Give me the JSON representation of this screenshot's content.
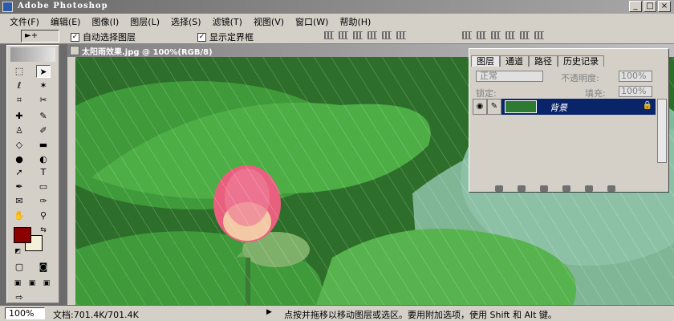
{
  "window": {
    "title": "Adobe Photoshop",
    "minimize": "_",
    "maximize": "□",
    "close": "×"
  },
  "menubar": {
    "items": [
      "文件(F)",
      "编辑(E)",
      "图像(I)",
      "图层(L)",
      "选择(S)",
      "滤镜(T)",
      "视图(V)",
      "窗口(W)",
      "帮助(H)"
    ]
  },
  "options": {
    "tool_preset": "►+",
    "auto_select_label": "自动选择图层",
    "auto_select_checked": "✓",
    "show_bounds_label": "显示定界框",
    "show_bounds_checked": "✓"
  },
  "document": {
    "title": "太阳雨效果.jpg @ 100%(RGB/8)"
  },
  "layers_panel": {
    "tabs": [
      "图层",
      "通道",
      "路径",
      "历史记录"
    ],
    "blend_mode": "正常",
    "opacity_label": "不透明度:",
    "opacity_value": "100%",
    "lock_label": "锁定:",
    "fill_label": "填充:",
    "fill_value": "100%",
    "layer_name": "背景"
  },
  "status": {
    "zoom": "100%",
    "doc_size": "文档:701.4K/701.4K",
    "arrow": "▶",
    "hint": "点按并拖移以移动图层或选区。要用附加选项，使用 Shift 和 Alt 键。"
  },
  "colors": {
    "foreground": "#8b0000",
    "background": "#f5f0d8",
    "selection": "#0a246a"
  }
}
